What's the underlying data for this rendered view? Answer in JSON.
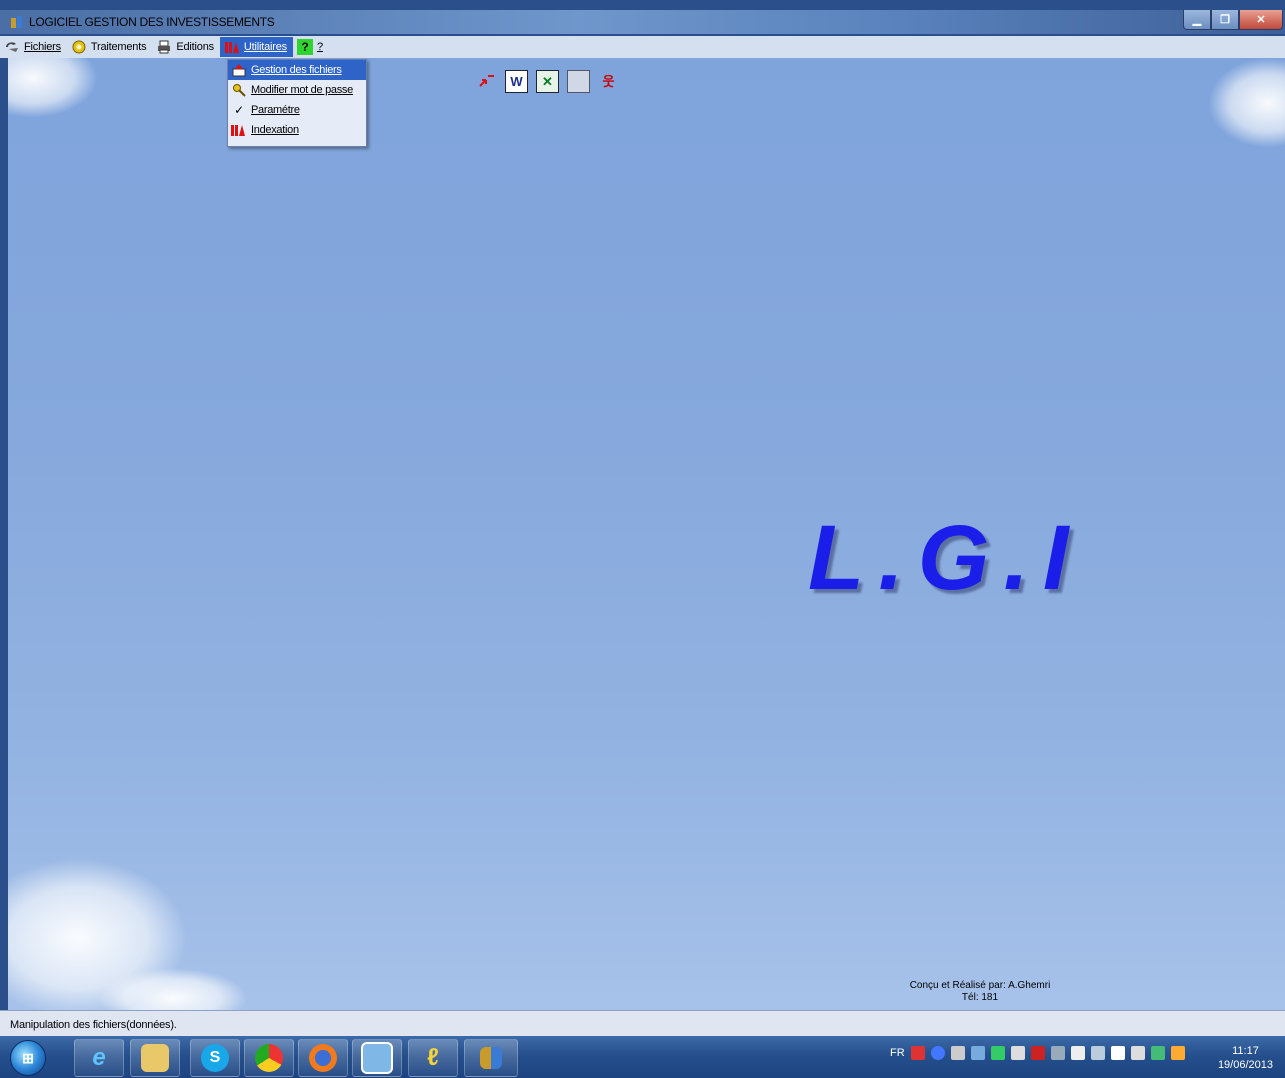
{
  "window": {
    "title": "LOGICIEL GESTION DES INVESTISSEMENTS",
    "controls": [
      "minimize",
      "restore",
      "close"
    ]
  },
  "menubar": {
    "items": [
      {
        "label": "Fichiers",
        "icon": "fichiers-icon"
      },
      {
        "label": "Traitements",
        "icon": "gear-icon"
      },
      {
        "label": "Editions",
        "icon": "printer-icon"
      },
      {
        "label": "Utilitaires",
        "icon": "tools-icon"
      },
      {
        "label": "?",
        "icon": "help-icon"
      }
    ]
  },
  "dropdown": {
    "items": [
      {
        "label": "Gestion des fichiers",
        "icon": "file-upload-icon",
        "highlighted": true
      },
      {
        "label": "Modifier mot de passe",
        "icon": "key-icon"
      },
      {
        "label": "Paramétre",
        "icon": "checkmark-icon"
      },
      {
        "label": "Indexation",
        "icon": "index-icon"
      }
    ]
  },
  "toolbar": {
    "icons": [
      "exit-icon",
      "word-icon",
      "excel-icon",
      "calculator-icon",
      "user-icon"
    ]
  },
  "logo": {
    "text": "L.G.I"
  },
  "credits": {
    "line1": "Conçu et Réalisé par: A.Ghemri",
    "line2": "Tél: 181"
  },
  "statusbar": {
    "text": "Manipulation des fichiers(données)."
  },
  "taskbar": {
    "apps": [
      "windows-start-icon",
      "internet-explorer-icon",
      "file-explorer-icon",
      "skype-icon",
      "chrome-icon",
      "firefox-icon",
      "photo-viewer-icon",
      "pen-app-icon",
      "lgi-app-icon"
    ],
    "tray_lang": "FR",
    "clock_time": "11:17",
    "clock_date": "19/06/2013"
  },
  "colors": {
    "logo": "#1a1ee8",
    "highlight": "#2e63c7"
  }
}
